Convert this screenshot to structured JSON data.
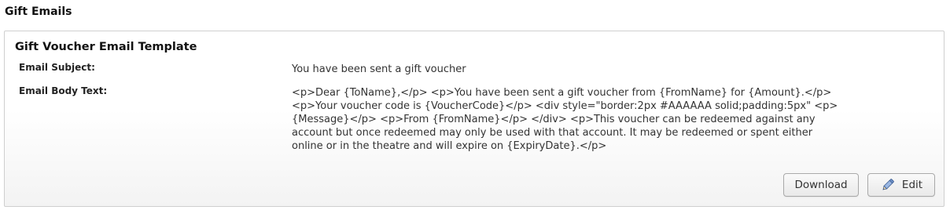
{
  "page": {
    "heading": "Gift Emails"
  },
  "panel": {
    "title": "Gift Voucher Email Template",
    "subject_label": "Email Subject:",
    "subject_value": "You have been sent a gift voucher",
    "body_label": "Email Body Text:",
    "body_value": "<p>Dear {ToName},</p> <p>You have been sent a gift voucher from {FromName} for {Amount}.</p> <p>Your voucher code is {VoucherCode}</p> <div style=\"border:2px #AAAAAA solid;padding:5px\" <p>{Message}</p> <p>From {FromName}</p> </div> <p>This voucher can be redeemed against any account but once redeemed may only be used with that account. It may be redeemed or spent either online or in the theatre and will expire on {ExpiryDate}.</p>"
  },
  "actions": {
    "download_label": "Download",
    "edit_label": "Edit",
    "edit_icon": "pencil-icon"
  }
}
